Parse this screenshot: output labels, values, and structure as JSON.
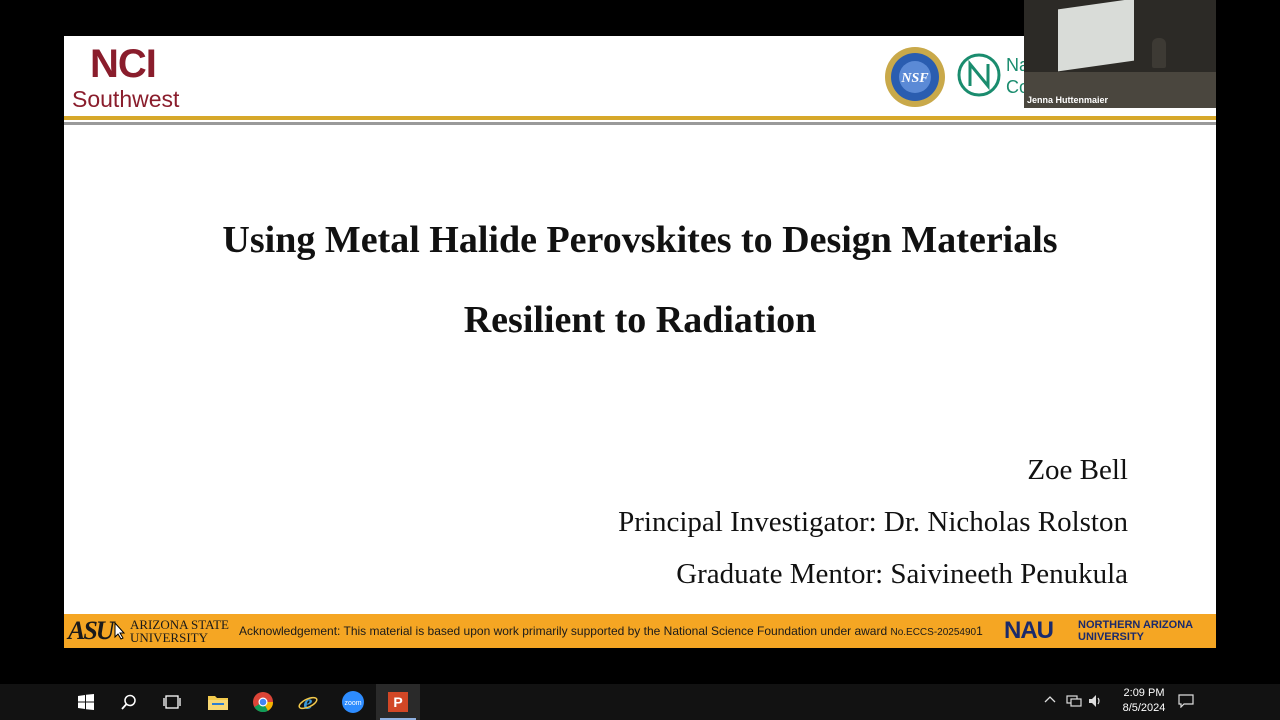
{
  "slide": {
    "logo_nci_main": "NCI",
    "logo_nci_sub": "Southwest",
    "nsf_logo_text": "NSF",
    "partner_logo_text_1": "Na",
    "partner_logo_text_2": "Co",
    "title_line1": "Using Metal Halide Perovskites to Design Materials",
    "title_line2": "Resilient to Radiation",
    "author": "Zoe Bell",
    "principal_investigator": "Principal Investigator: Dr. Nicholas Rolston",
    "graduate_mentor": "Graduate Mentor: Saivineeth Penukula"
  },
  "footer": {
    "asu_mark": "ASU",
    "asu_name_line1": "ARIZONA STATE",
    "asu_name_line2": "UNIVERSITY",
    "acknowledgement": "Acknowledgement: This material is based upon work primarily supported by the National Science Foundation  under award ",
    "award_number": "No.ECCS-2025490",
    "slide_number": "1",
    "nau_mark": "NAU",
    "nau_name_line1": "NORTHERN ARIZONA",
    "nau_name_line2": "UNIVERSITY"
  },
  "webcam": {
    "participant_name": "Jenna Huttenmaier"
  },
  "taskbar": {
    "time": "2:09 PM",
    "date": "8/5/2024",
    "zoom_icon_text": "zoom",
    "powerpoint_icon_text": "P"
  },
  "colors": {
    "nci_maroon": "#8a1d2c",
    "footer_gold": "#f5a623",
    "nau_blue": "#1a2a6c",
    "taskbar_bg": "#121212"
  }
}
